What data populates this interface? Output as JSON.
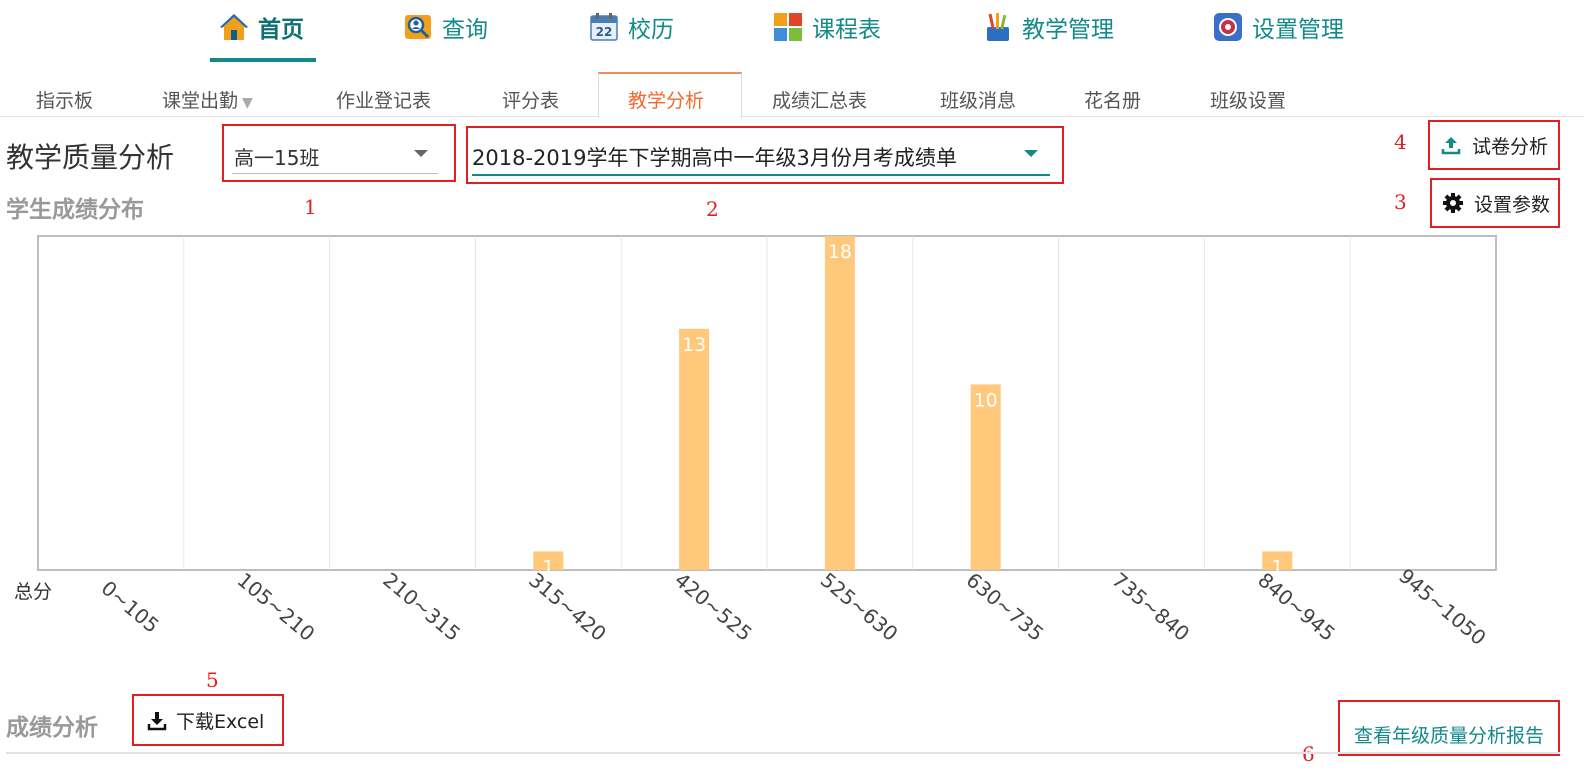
{
  "topnav": {
    "items": [
      {
        "label": "首页",
        "icon": "house-icon"
      },
      {
        "label": "查询",
        "icon": "search-person-icon"
      },
      {
        "label": "校历",
        "icon": "calendar-icon"
      },
      {
        "label": "课程表",
        "icon": "timetable-icon"
      },
      {
        "label": "教学管理",
        "icon": "pencil-cup-icon"
      },
      {
        "label": "设置管理",
        "icon": "gear-icon"
      }
    ],
    "calendar_day": "22"
  },
  "subtabs": {
    "items": [
      "指示板",
      "课堂出勤",
      "作业登记表",
      "评分表",
      "教学分析",
      "成绩汇总表",
      "班级消息",
      "花名册",
      "班级设置"
    ],
    "active": "教学分析",
    "caret": "▼"
  },
  "header": {
    "title": "教学质量分析",
    "class_select": "高一15班",
    "exam_select": "2018-2019学年下学期高中一年级3月份月考成绩单"
  },
  "annotations": [
    "1",
    "2",
    "3",
    "4",
    "5",
    "6"
  ],
  "buttons": {
    "paper_analysis": "试卷分析",
    "set_params": "设置参数",
    "download_excel": "下载Excel",
    "view_grade_report": "查看年级质量分析报告"
  },
  "sections": {
    "score_distribution": "学生成绩分布",
    "score_analysis": "成绩分析"
  },
  "chart_data": {
    "type": "bar",
    "title": "",
    "xlabel": "总分",
    "ylabel": "",
    "categories": [
      "0~105",
      "105~210",
      "210~315",
      "315~420",
      "420~525",
      "525~630",
      "630~735",
      "735~840",
      "840~945",
      "945~1050"
    ],
    "values": [
      0,
      0,
      0,
      1,
      13,
      18,
      10,
      0,
      1,
      0
    ],
    "ylim": [
      0,
      18
    ],
    "grid": "vertical",
    "bar_color": "#ffc87a"
  },
  "colors": {
    "accent": "#138a8a",
    "active_tab": "#f06a30",
    "annotation": "#e02020"
  }
}
